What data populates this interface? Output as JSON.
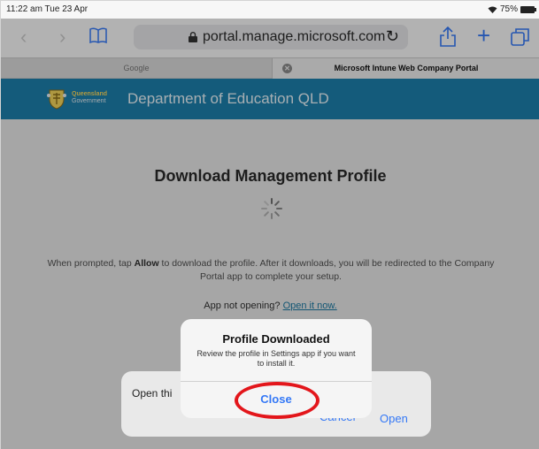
{
  "status_bar": {
    "time": "11:22 am  Tue 23 Apr",
    "battery": "75%"
  },
  "toolbar": {
    "url": "portal.manage.microsoft.com",
    "icons": [
      "back-icon",
      "forward-icon",
      "bookmarks-icon",
      "lock-icon",
      "reload-icon",
      "share-icon",
      "new-tab-icon",
      "tabs-icon"
    ]
  },
  "tabs": [
    {
      "label": "Google"
    },
    {
      "label": "Microsoft Intune Web Company Portal"
    }
  ],
  "header": {
    "gov_line1": "Queensland",
    "gov_line2": "Government",
    "title": "Department of Education QLD"
  },
  "main": {
    "title": "Download Management Profile",
    "instr_prefix": "When prompted, tap ",
    "instr_bold": "Allow",
    "instr_suffix": " to download the profile. After it downloads, you will be redirected to the Company Portal app to complete your setup.",
    "not_opening": "App not opening?",
    "open_link": "Open it now."
  },
  "open_sheet": {
    "text": "Open thi",
    "cancel": "Cancel",
    "open": "Open"
  },
  "alert": {
    "title": "Profile Downloaded",
    "message": "Review the profile in Settings app if you want to install it.",
    "close": "Close"
  },
  "colors": {
    "header_blue": "#1c7fab",
    "accent": "#3478f6",
    "highlight": "#e3161b"
  }
}
